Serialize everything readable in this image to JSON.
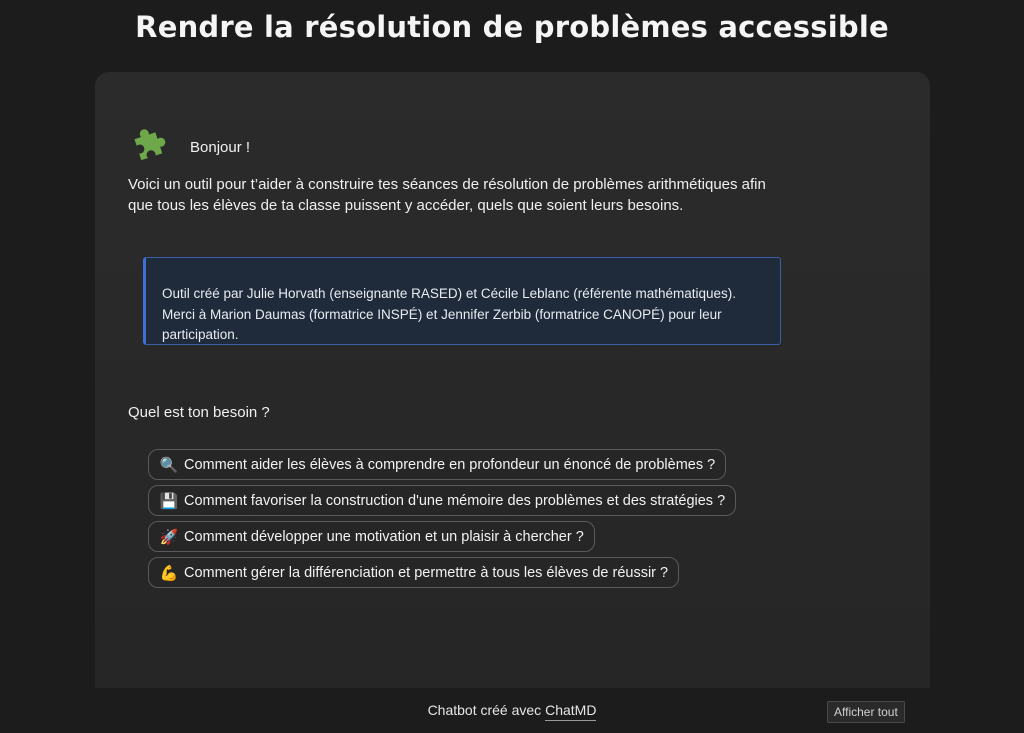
{
  "page": {
    "title": "Rendre la résolution de problèmes accessible"
  },
  "chat": {
    "avatar_icon": "puzzle-piece-icon",
    "avatar_color": "#6fa84a",
    "greeting": "Bonjour !",
    "intro": "Voici un outil pour t’aider à construire tes séances de résolution de problèmes arithmétiques afin que tous les élèves de ta classe puissent y accéder, quels que soient leurs besoins.",
    "credits": "Outil créé par Julie Horvath (enseignante RASED) et Cécile Leblanc (référente mathématiques). Merci à Marion Daumas (formatrice INSPÉ) et Jennifer Zerbib (formatrice CANOPÉ) pour leur participation.",
    "question": "Quel est ton besoin ?",
    "choices": [
      {
        "icon": "🔍",
        "icon_name": "magnifying-glass-icon",
        "label": "Comment aider les élèves à comprendre en profondeur un énoncé de problèmes ?"
      },
      {
        "icon": "💾",
        "icon_name": "floppy-disk-icon",
        "label": "Comment favoriser la construction d'une mémoire des problèmes et des stratégies ?"
      },
      {
        "icon": "🚀",
        "icon_name": "rocket-icon",
        "label": "Comment développer une motivation et un plaisir à chercher ?"
      },
      {
        "icon": "💪",
        "icon_name": "flexed-biceps-icon",
        "label": "Comment gérer la différenciation et permettre à tous les élèves de réussir ?"
      }
    ]
  },
  "footer": {
    "prefix": "Chatbot créé avec ",
    "link": "ChatMD",
    "show_all_label": "Afficher tout"
  },
  "colors": {
    "background": "#1c1c1c",
    "panel": "#2b2b2b",
    "credits_bg": "#1f2a3a",
    "credits_accent": "#3d6fd6"
  }
}
